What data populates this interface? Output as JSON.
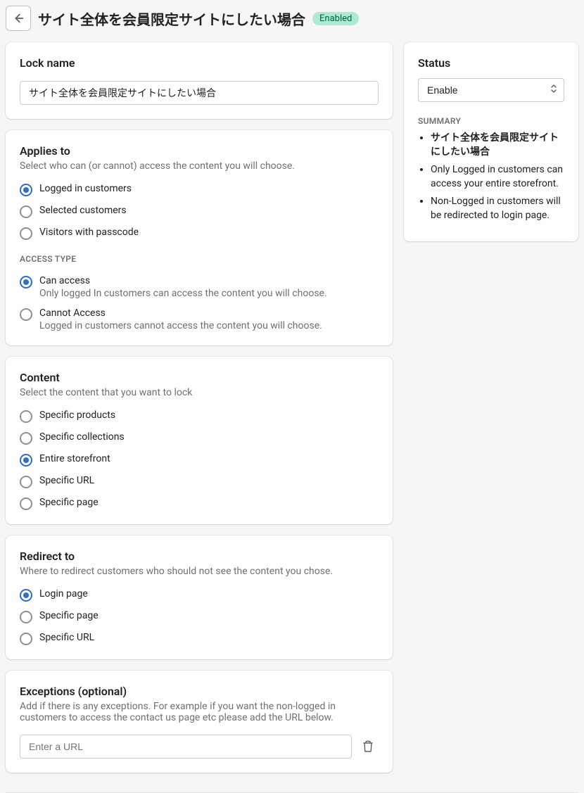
{
  "header": {
    "title": "サイト全体を会員限定サイトにしたい場合",
    "badge": "Enabled"
  },
  "lockname": {
    "title": "Lock name",
    "value": "サイト全体を会員限定サイトにしたい場合"
  },
  "applies": {
    "title": "Applies to",
    "sub": "Select who can (or cannot) access the content you will choose.",
    "options": [
      {
        "label": "Logged in customers",
        "checked": true
      },
      {
        "label": "Selected customers",
        "checked": false
      },
      {
        "label": "Visitors with passcode",
        "checked": false
      }
    ]
  },
  "accesstype": {
    "heading": "ACCESS TYPE",
    "options": [
      {
        "label": "Can access",
        "desc": "Only logged In customers can access the content you will choose.",
        "checked": true
      },
      {
        "label": "Cannot Access",
        "desc": "Logged in customers cannot access the content you will choose.",
        "checked": false
      }
    ]
  },
  "content": {
    "title": "Content",
    "sub": "Select the content that you want to lock",
    "options": [
      {
        "label": "Specific products",
        "checked": false
      },
      {
        "label": "Specific collections",
        "checked": false
      },
      {
        "label": "Entire storefront",
        "checked": true
      },
      {
        "label": "Specific URL",
        "checked": false
      },
      {
        "label": "Specific page",
        "checked": false
      }
    ]
  },
  "redirect": {
    "title": "Redirect to",
    "sub": "Where to redirect customers who should not see the content you chose.",
    "options": [
      {
        "label": "Login page",
        "checked": true
      },
      {
        "label": "Specific page",
        "checked": false
      },
      {
        "label": "Specific URL",
        "checked": false
      }
    ]
  },
  "exceptions": {
    "title": "Exceptions (optional)",
    "sub": "Add if there is any exceptions. For example if you want the non-logged in customers to access the contact us page etc please add the URL below.",
    "placeholder": "Enter a URL"
  },
  "sidebar": {
    "status": {
      "title": "Status",
      "selected": "Enable"
    },
    "summary": {
      "heading": "SUMMARY",
      "items": [
        "サイト全体を会員限定サイトにしたい場合",
        "Only Logged in customers can access your entire storefront.",
        "Non-Logged in customers will be redirected to login page."
      ]
    }
  }
}
